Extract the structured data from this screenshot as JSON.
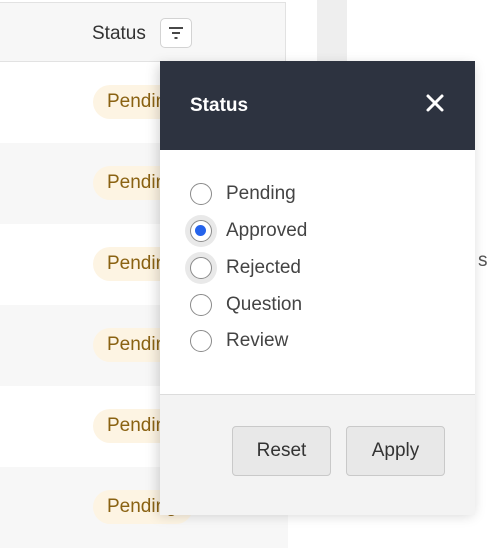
{
  "table": {
    "column_header": "Status",
    "rows": [
      {
        "status": "Pending"
      },
      {
        "status": "Pending"
      },
      {
        "status": "Pending"
      },
      {
        "status": "Pending"
      },
      {
        "status": "Pending"
      },
      {
        "status": "Pending"
      }
    ]
  },
  "right_panel": {
    "partial_text": "si"
  },
  "filter_popup": {
    "title": "Status",
    "close_icon": "close-icon",
    "options": [
      {
        "label": "Pending",
        "selected": false
      },
      {
        "label": "Approved",
        "selected": true
      },
      {
        "label": "Rejected",
        "selected": false
      },
      {
        "label": "Question",
        "selected": false
      },
      {
        "label": "Review",
        "selected": false
      }
    ],
    "reset_label": "Reset",
    "apply_label": "Apply"
  },
  "colors": {
    "header_bg": "#2d3340",
    "radio_selected": "#2563eb",
    "badge_bg": "#fdf4e3",
    "badge_text": "#8a6212"
  }
}
